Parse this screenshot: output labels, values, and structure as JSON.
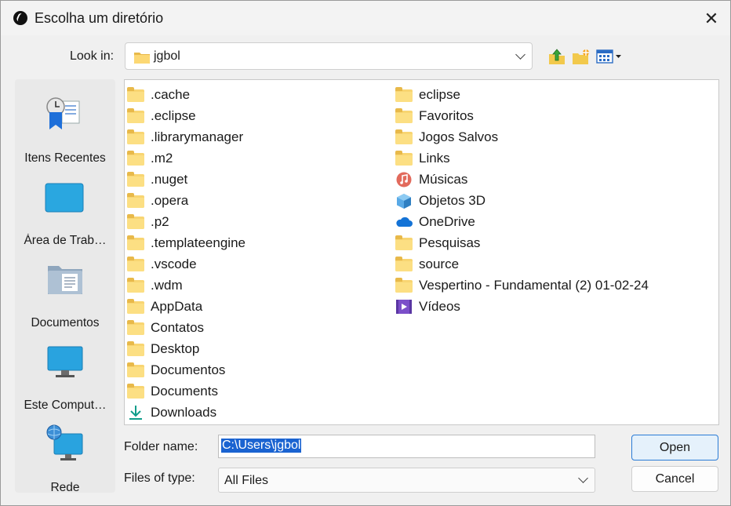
{
  "window": {
    "title": "Escolha um diretório",
    "close_glyph": "✕"
  },
  "toolbar": {
    "look_in_label": "Look in:",
    "look_in_value": "jgbol",
    "icons": [
      "up-folder-icon",
      "new-folder-icon",
      "view-menu-icon"
    ]
  },
  "sidebar": {
    "items": [
      {
        "label": "Itens Recentes",
        "icon": "recent-items-icon"
      },
      {
        "label": "Área de Trab…",
        "icon": "desktop-icon"
      },
      {
        "label": "Documentos",
        "icon": "documents-icon"
      },
      {
        "label": "Este Comput…",
        "icon": "this-computer-icon"
      },
      {
        "label": "Rede",
        "icon": "network-icon"
      }
    ]
  },
  "files": {
    "column1": [
      {
        "name": ".cache",
        "icon": "folder"
      },
      {
        "name": ".eclipse",
        "icon": "folder"
      },
      {
        "name": ".librarymanager",
        "icon": "folder"
      },
      {
        "name": ".m2",
        "icon": "folder"
      },
      {
        "name": ".nuget",
        "icon": "folder"
      },
      {
        "name": ".opera",
        "icon": "folder"
      },
      {
        "name": ".p2",
        "icon": "folder"
      },
      {
        "name": ".templateengine",
        "icon": "folder"
      },
      {
        "name": ".vscode",
        "icon": "folder"
      },
      {
        "name": ".wdm",
        "icon": "folder"
      },
      {
        "name": "AppData",
        "icon": "folder"
      },
      {
        "name": "Contatos",
        "icon": "folder"
      },
      {
        "name": "Desktop",
        "icon": "folder"
      },
      {
        "name": "Documentos",
        "icon": "folder"
      },
      {
        "name": "Documents",
        "icon": "folder"
      },
      {
        "name": "Downloads",
        "icon": "download"
      }
    ],
    "column2": [
      {
        "name": "eclipse",
        "icon": "folder"
      },
      {
        "name": "Favoritos",
        "icon": "folder"
      },
      {
        "name": "Jogos Salvos",
        "icon": "folder"
      },
      {
        "name": "Links",
        "icon": "folder"
      },
      {
        "name": "Músicas",
        "icon": "music"
      },
      {
        "name": "Objetos 3D",
        "icon": "cube"
      },
      {
        "name": "OneDrive",
        "icon": "cloud"
      },
      {
        "name": "Pesquisas",
        "icon": "folder"
      },
      {
        "name": "source",
        "icon": "folder"
      },
      {
        "name": "Vespertino - Fundamental (2) 01-02-24",
        "icon": "folder"
      },
      {
        "name": "Vídeos",
        "icon": "video"
      }
    ]
  },
  "footer": {
    "folder_name_label": "Folder name:",
    "folder_name_value": "C:\\Users\\jgbol",
    "files_of_type_label": "Files of type:",
    "files_of_type_value": "All Files",
    "open_label": "Open",
    "cancel_label": "Cancel"
  },
  "colors": {
    "selection": "#1a63d1",
    "focus_border": "#2a7bd6",
    "folder": "#f8d572"
  }
}
